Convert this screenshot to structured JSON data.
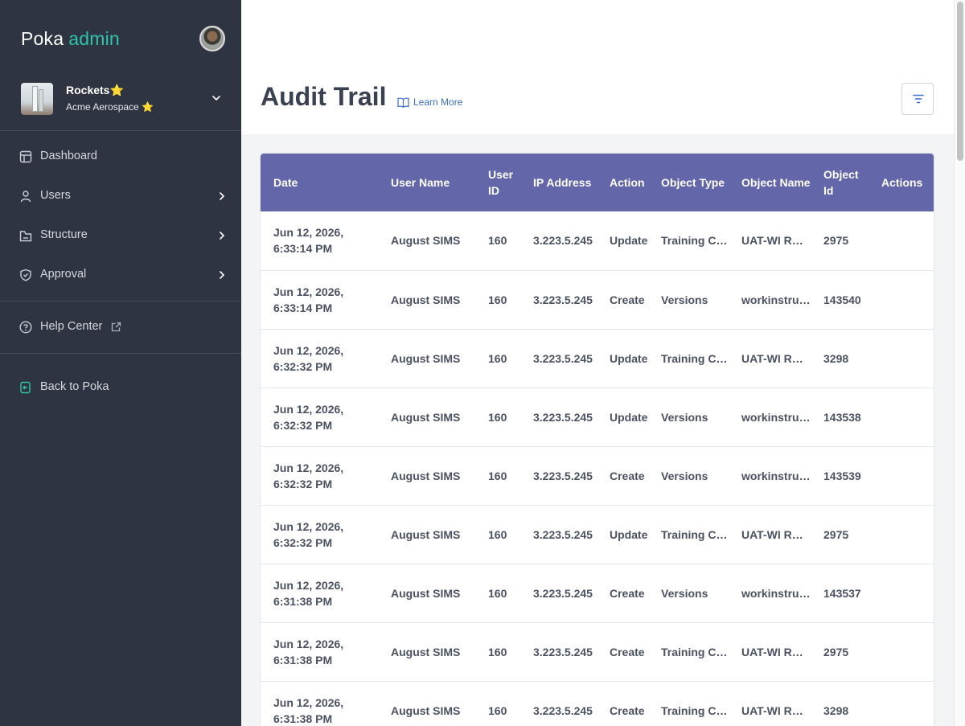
{
  "sidebar": {
    "logo_main": "Poka",
    "logo_accent": "admin",
    "org_name": "Rockets⭐",
    "org_sub": "Acme Aerospace ⭐",
    "nav": [
      {
        "label": "Dashboard",
        "icon": "dashboard-icon",
        "has_arrow": false
      },
      {
        "label": "Users",
        "icon": "user-icon",
        "has_arrow": true
      },
      {
        "label": "Structure",
        "icon": "structure-icon",
        "has_arrow": true
      },
      {
        "label": "Approval",
        "icon": "shield-check-icon",
        "has_arrow": true
      }
    ],
    "help_label": "Help Center",
    "back_label": "Back to Poka"
  },
  "header": {
    "title": "Audit Trail",
    "learn_more": "Learn More"
  },
  "table": {
    "columns": [
      "Date",
      "User Name",
      "User ID",
      "IP Address",
      "Action",
      "Object Type",
      "Object Name",
      "Object Id",
      "Actions"
    ],
    "rows": [
      {
        "date1": "Jun 12, 2026,",
        "date2": "6:33:14 PM",
        "user": "August SIMS",
        "uid": "160",
        "ip": "3.223.5.245",
        "action": "Update",
        "otype": "Training C…",
        "oname": "UAT-WI RE…",
        "oid": "2975"
      },
      {
        "date1": "Jun 12, 2026,",
        "date2": "6:33:14 PM",
        "user": "August SIMS",
        "uid": "160",
        "ip": "3.223.5.245",
        "action": "Create",
        "otype": "Versions",
        "oname": "workinstru…",
        "oid": "143540"
      },
      {
        "date1": "Jun 12, 2026,",
        "date2": "6:32:32 PM",
        "user": "August SIMS",
        "uid": "160",
        "ip": "3.223.5.245",
        "action": "Update",
        "otype": "Training C…",
        "oname": "UAT-WI RE…",
        "oid": "3298"
      },
      {
        "date1": "Jun 12, 2026,",
        "date2": "6:32:32 PM",
        "user": "August SIMS",
        "uid": "160",
        "ip": "3.223.5.245",
        "action": "Update",
        "otype": "Versions",
        "oname": "workinstru…",
        "oid": "143538"
      },
      {
        "date1": "Jun 12, 2026,",
        "date2": "6:32:32 PM",
        "user": "August SIMS",
        "uid": "160",
        "ip": "3.223.5.245",
        "action": "Create",
        "otype": "Versions",
        "oname": "workinstru…",
        "oid": "143539"
      },
      {
        "date1": "Jun 12, 2026,",
        "date2": "6:32:32 PM",
        "user": "August SIMS",
        "uid": "160",
        "ip": "3.223.5.245",
        "action": "Update",
        "otype": "Training C…",
        "oname": "UAT-WI RE…",
        "oid": "2975"
      },
      {
        "date1": "Jun 12, 2026,",
        "date2": "6:31:38 PM",
        "user": "August SIMS",
        "uid": "160",
        "ip": "3.223.5.245",
        "action": "Create",
        "otype": "Versions",
        "oname": "workinstru…",
        "oid": "143537"
      },
      {
        "date1": "Jun 12, 2026,",
        "date2": "6:31:38 PM",
        "user": "August SIMS",
        "uid": "160",
        "ip": "3.223.5.245",
        "action": "Create",
        "otype": "Training C…",
        "oname": "UAT-WI RE…",
        "oid": "2975"
      },
      {
        "date1": "Jun 12, 2026,",
        "date2": "6:31:38 PM",
        "user": "August SIMS",
        "uid": "160",
        "ip": "3.223.5.245",
        "action": "Create",
        "otype": "Training C…",
        "oname": "UAT-WI RE…",
        "oid": "3298"
      }
    ]
  },
  "colors": {
    "sidebar_bg": "#2e3441",
    "accent": "#2ec4a8",
    "table_header_bg": "#6366a8",
    "link": "#3b6fd1"
  }
}
